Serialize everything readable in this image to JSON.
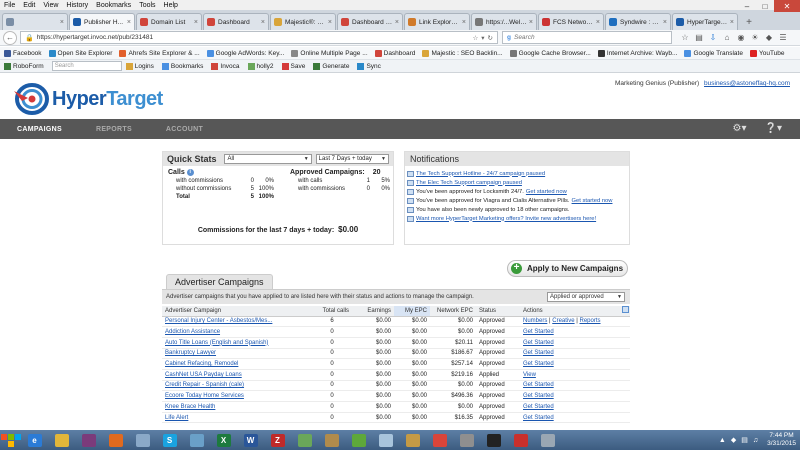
{
  "browser": {
    "menus": [
      "File",
      "Edit",
      "View",
      "History",
      "Bookmarks",
      "Tools",
      "Help"
    ],
    "tabs": [
      {
        "label": "",
        "color": "#7a8ea6"
      },
      {
        "label": "Publisher H...",
        "color": "#1c5ca8",
        "active": true
      },
      {
        "label": "Domain List",
        "color": "#d0453b"
      },
      {
        "label": "Dashboard",
        "color": "#d0453b"
      },
      {
        "label": "Majestic®: Mar...",
        "color": "#d9a53a"
      },
      {
        "label": "Dashboard - Ah...",
        "color": "#d0453b"
      },
      {
        "label": "Link Explorer - ...",
        "color": "#d07a2b"
      },
      {
        "label": "https:/...Welcome",
        "color": "#777"
      },
      {
        "label": "FCS Networker",
        "color": "#c33"
      },
      {
        "label": "Syndwire : Thir...",
        "color": "#1f6fbf"
      },
      {
        "label": "HyperTarget M...",
        "color": "#1c5ca8"
      }
    ],
    "url": "https://hypertarget.invoc.net/pub/231481",
    "search_placeholder": "Search",
    "bookmarks": [
      {
        "label": "Facebook",
        "color": "#3b5998"
      },
      {
        "label": "Open Site Explorer",
        "color": "#2a89c9"
      },
      {
        "label": "Ahrefs Site Explorer & ...",
        "color": "#e25f2b"
      },
      {
        "label": "Google AdWords: Key...",
        "color": "#4a90e2"
      },
      {
        "label": "Online Multiple Page ...",
        "color": "#888"
      },
      {
        "label": "Dashboard",
        "color": "#d0453b"
      },
      {
        "label": "Majestic : SEO Backlin...",
        "color": "#d9a53a"
      },
      {
        "label": "Google Cache Browser...",
        "color": "#777"
      },
      {
        "label": "Internet Archive: Wayb...",
        "color": "#333"
      },
      {
        "label": "Google Translate",
        "color": "#4a90e2"
      },
      {
        "label": "YouTube",
        "color": "#d22"
      }
    ],
    "toolbar2": {
      "roboform": "RoboForm",
      "search_placeholder": "Search",
      "items": [
        "Logins",
        "Bookmarks",
        "Invoca",
        "holly2",
        "Save",
        "Generate",
        "Sync"
      ]
    }
  },
  "app": {
    "logo_main": "Hyper",
    "logo_accent": "Target",
    "user_name": "Marketing Genius (Publisher)",
    "user_email": "business@astoneffaq-hq.com",
    "nav": [
      {
        "label": "CAMPAIGNS",
        "active": true
      },
      {
        "label": "REPORTS"
      },
      {
        "label": "ACCOUNT"
      }
    ]
  },
  "quick_stats": {
    "title": "Quick Stats",
    "filter_all": "All",
    "filter_range": "Last 7 Days + today",
    "calls_label": "Calls",
    "calls_rows": [
      {
        "label": "with commissions",
        "n": "0",
        "p": "0%"
      },
      {
        "label": "without commissions",
        "n": "5",
        "p": "100%"
      },
      {
        "label": "Total",
        "n": "5",
        "p": "100%",
        "total": true
      }
    ],
    "approved_label": "Approved Campaigns:",
    "approved_count": "20",
    "approved_rows": [
      {
        "label": "with calls",
        "n": "1",
        "p": "5%"
      },
      {
        "label": "with commissions",
        "n": "0",
        "p": "0%"
      }
    ],
    "commissions_label": "Commissions for the last 7 days + today:",
    "commissions_value": "$0.00"
  },
  "notifications": {
    "title": "Notifications",
    "items": [
      {
        "text": "The Tech Support Hotline - 24/7 campaign paused",
        "link": true
      },
      {
        "text": "The Elec Tech Support campaign paused",
        "link": true
      },
      {
        "text": "You've been approved for Locksmith 24/7.",
        "action": "Get started now"
      },
      {
        "text": "You've been approved for Viagra and Cialis Alternative Pills.",
        "action": "Get started now"
      },
      {
        "text": "You have also been newly approved to 18 other campaigns."
      },
      {
        "text": "Want more HyperTarget Marketing offers? Invite new advertisers here!",
        "link": true
      }
    ]
  },
  "apply_button": "Apply to New Campaigns",
  "campaigns": {
    "tab": "Advertiser Campaigns",
    "description": "Advertiser campaigns that you have applied to are listed here with their status and actions to manage the campaign.",
    "filter": "Applied or approved",
    "headers": [
      "Advertiser Campaign",
      "Total calls",
      "Earnings",
      "My EPC",
      "Network EPC",
      "Status",
      "Actions"
    ],
    "rows": [
      {
        "name": "Personal Injury Center - Asbestos/Mes...",
        "calls": "6",
        "earnings": "$0.00",
        "my_epc": "$0.00",
        "net_epc": "$0.00",
        "status": "Approved",
        "actions": [
          "Numbers",
          "Creative",
          "Reports"
        ]
      },
      {
        "name": "Addiction Assistance",
        "calls": "0",
        "earnings": "$0.00",
        "my_epc": "$0.00",
        "net_epc": "$0.00",
        "status": "Approved",
        "actions": [
          "Get Started"
        ]
      },
      {
        "name": "Auto Title Loans (English and Spanish)",
        "calls": "0",
        "earnings": "$0.00",
        "my_epc": "$0.00",
        "net_epc": "$20.11",
        "status": "Approved",
        "actions": [
          "Get Started"
        ]
      },
      {
        "name": "Bankruptcy Lawyer",
        "calls": "0",
        "earnings": "$0.00",
        "my_epc": "$0.00",
        "net_epc": "$186.67",
        "status": "Approved",
        "actions": [
          "Get Started"
        ]
      },
      {
        "name": "Cabinet Refacing, Remodel",
        "calls": "0",
        "earnings": "$0.00",
        "my_epc": "$0.00",
        "net_epc": "$257.14",
        "status": "Approved",
        "actions": [
          "Get Started"
        ]
      },
      {
        "name": "CashNet USA Payday Loans",
        "calls": "0",
        "earnings": "$0.00",
        "my_epc": "$0.00",
        "net_epc": "$219.16",
        "status": "Applied",
        "actions": [
          "View"
        ]
      },
      {
        "name": "Credit Repair - Spanish (cale)",
        "calls": "0",
        "earnings": "$0.00",
        "my_epc": "$0.00",
        "net_epc": "$0.00",
        "status": "Approved",
        "actions": [
          "Get Started"
        ]
      },
      {
        "name": "Ecoore Today Home Services",
        "calls": "0",
        "earnings": "$0.00",
        "my_epc": "$0.00",
        "net_epc": "$496.36",
        "status": "Approved",
        "actions": [
          "Get Started"
        ]
      },
      {
        "name": "Knee Brace Health",
        "calls": "0",
        "earnings": "$0.00",
        "my_epc": "$0.00",
        "net_epc": "$0.00",
        "status": "Approved",
        "actions": [
          "Get Started"
        ]
      },
      {
        "name": "Life Alert",
        "calls": "0",
        "earnings": "$0.00",
        "my_epc": "$0.00",
        "net_epc": "$16.35",
        "status": "Approved",
        "actions": [
          "Get Started"
        ]
      }
    ]
  },
  "taskbar": {
    "apps": [
      {
        "name": "ie",
        "glyph": "e",
        "color": "#2b7bd6"
      },
      {
        "name": "folder",
        "glyph": "",
        "color": "#e2b63a"
      },
      {
        "name": "media",
        "glyph": "",
        "color": "#7b3b7b"
      },
      {
        "name": "firefox",
        "glyph": "",
        "color": "#e06a1f"
      },
      {
        "name": "photos",
        "glyph": "",
        "color": "#8aa9c8"
      },
      {
        "name": "skype",
        "glyph": "S",
        "color": "#1aa3e0"
      },
      {
        "name": "network",
        "glyph": "",
        "color": "#6aa0c8"
      },
      {
        "name": "excel",
        "glyph": "X",
        "color": "#1d7a3e"
      },
      {
        "name": "word",
        "glyph": "W",
        "color": "#2a5699"
      },
      {
        "name": "filezilla",
        "glyph": "Z",
        "color": "#bf2a2a"
      },
      {
        "name": "app",
        "glyph": "",
        "color": "#6aa75a"
      },
      {
        "name": "box",
        "glyph": "",
        "color": "#b08b4c"
      },
      {
        "name": "utorrent",
        "glyph": "",
        "color": "#5ea83a"
      },
      {
        "name": "notepad",
        "glyph": "",
        "color": "#a8c4dc"
      },
      {
        "name": "archive",
        "glyph": "",
        "color": "#c49a45"
      },
      {
        "name": "chrome",
        "glyph": "",
        "color": "#d9453a"
      },
      {
        "name": "admin",
        "glyph": "",
        "color": "#8f8f8f"
      },
      {
        "name": "terminal",
        "glyph": "",
        "color": "#222"
      },
      {
        "name": "recorder",
        "glyph": "",
        "color": "#c9302c"
      },
      {
        "name": "shield",
        "glyph": "",
        "color": "#9aa7b3"
      }
    ],
    "time": "7:44 PM",
    "date": "3/31/2015"
  }
}
